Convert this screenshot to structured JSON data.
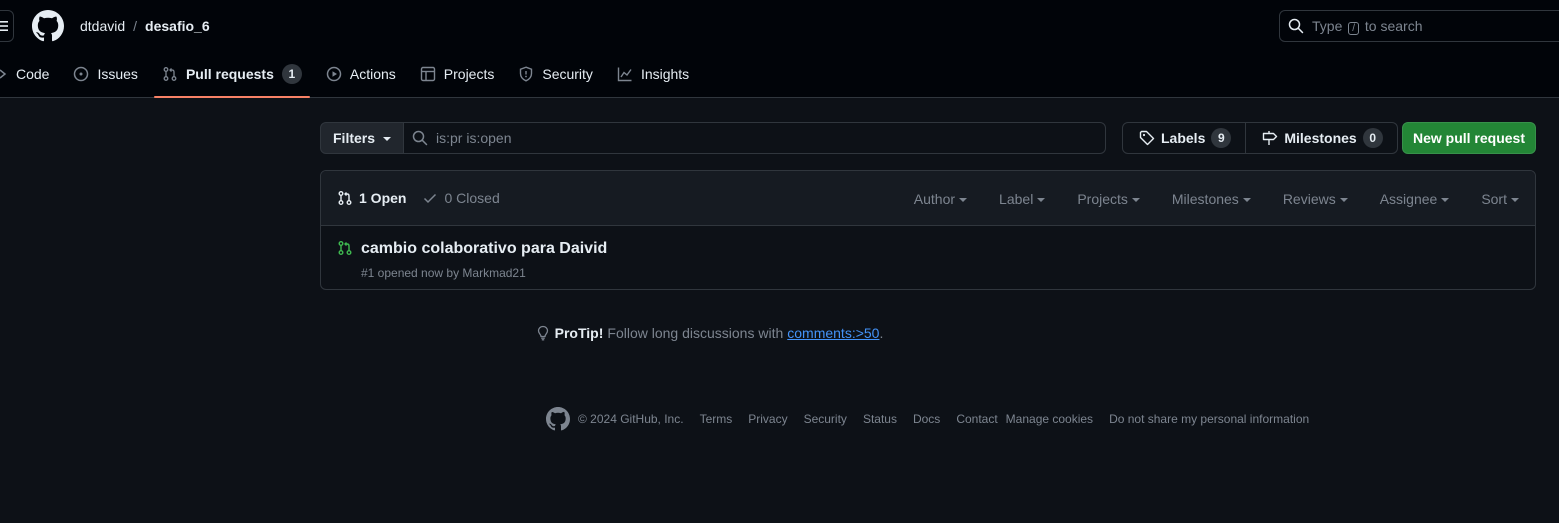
{
  "header": {
    "owner": "dtdavid",
    "separator": "/",
    "repo": "desafio_6",
    "search_prefix": "Type",
    "search_key": "/",
    "search_suffix": "to search"
  },
  "tabs": [
    {
      "label": "Code",
      "icon": "code-icon"
    },
    {
      "label": "Issues",
      "icon": "issue-opened-icon"
    },
    {
      "label": "Pull requests",
      "icon": "git-pull-request-icon",
      "count": "1",
      "selected": true
    },
    {
      "label": "Actions",
      "icon": "play-icon"
    },
    {
      "label": "Projects",
      "icon": "table-icon"
    },
    {
      "label": "Security",
      "icon": "shield-icon"
    },
    {
      "label": "Insights",
      "icon": "graph-icon"
    }
  ],
  "subnav": {
    "filters_label": "Filters",
    "query": "is:pr is:open",
    "labels_label": "Labels",
    "labels_count": "9",
    "milestones_label": "Milestones",
    "milestones_count": "0",
    "new_pr_label": "New pull request"
  },
  "list": {
    "open_label": "1 Open",
    "closed_label": "0 Closed",
    "filters": [
      "Author",
      "Label",
      "Projects",
      "Milestones",
      "Reviews",
      "Assignee",
      "Sort"
    ],
    "items": [
      {
        "title": "cambio colaborativo para Daivid",
        "meta": "#1 opened now by Markmad21"
      }
    ]
  },
  "protip": {
    "strong": "ProTip!",
    "text": "Follow long discussions with",
    "link": "comments:>50",
    "end": "."
  },
  "footer": {
    "copyright": "© 2024 GitHub, Inc.",
    "links": [
      "Terms",
      "Privacy",
      "Security",
      "Status",
      "Docs",
      "Contact",
      "Manage cookies",
      "Do not share my personal information"
    ]
  },
  "colors": {
    "bg": "#0d1117",
    "header_bg": "#010409",
    "accent_underline": "#f78166",
    "open_green": "#3fb950",
    "primary_button": "#238636",
    "link": "#4493f8"
  }
}
